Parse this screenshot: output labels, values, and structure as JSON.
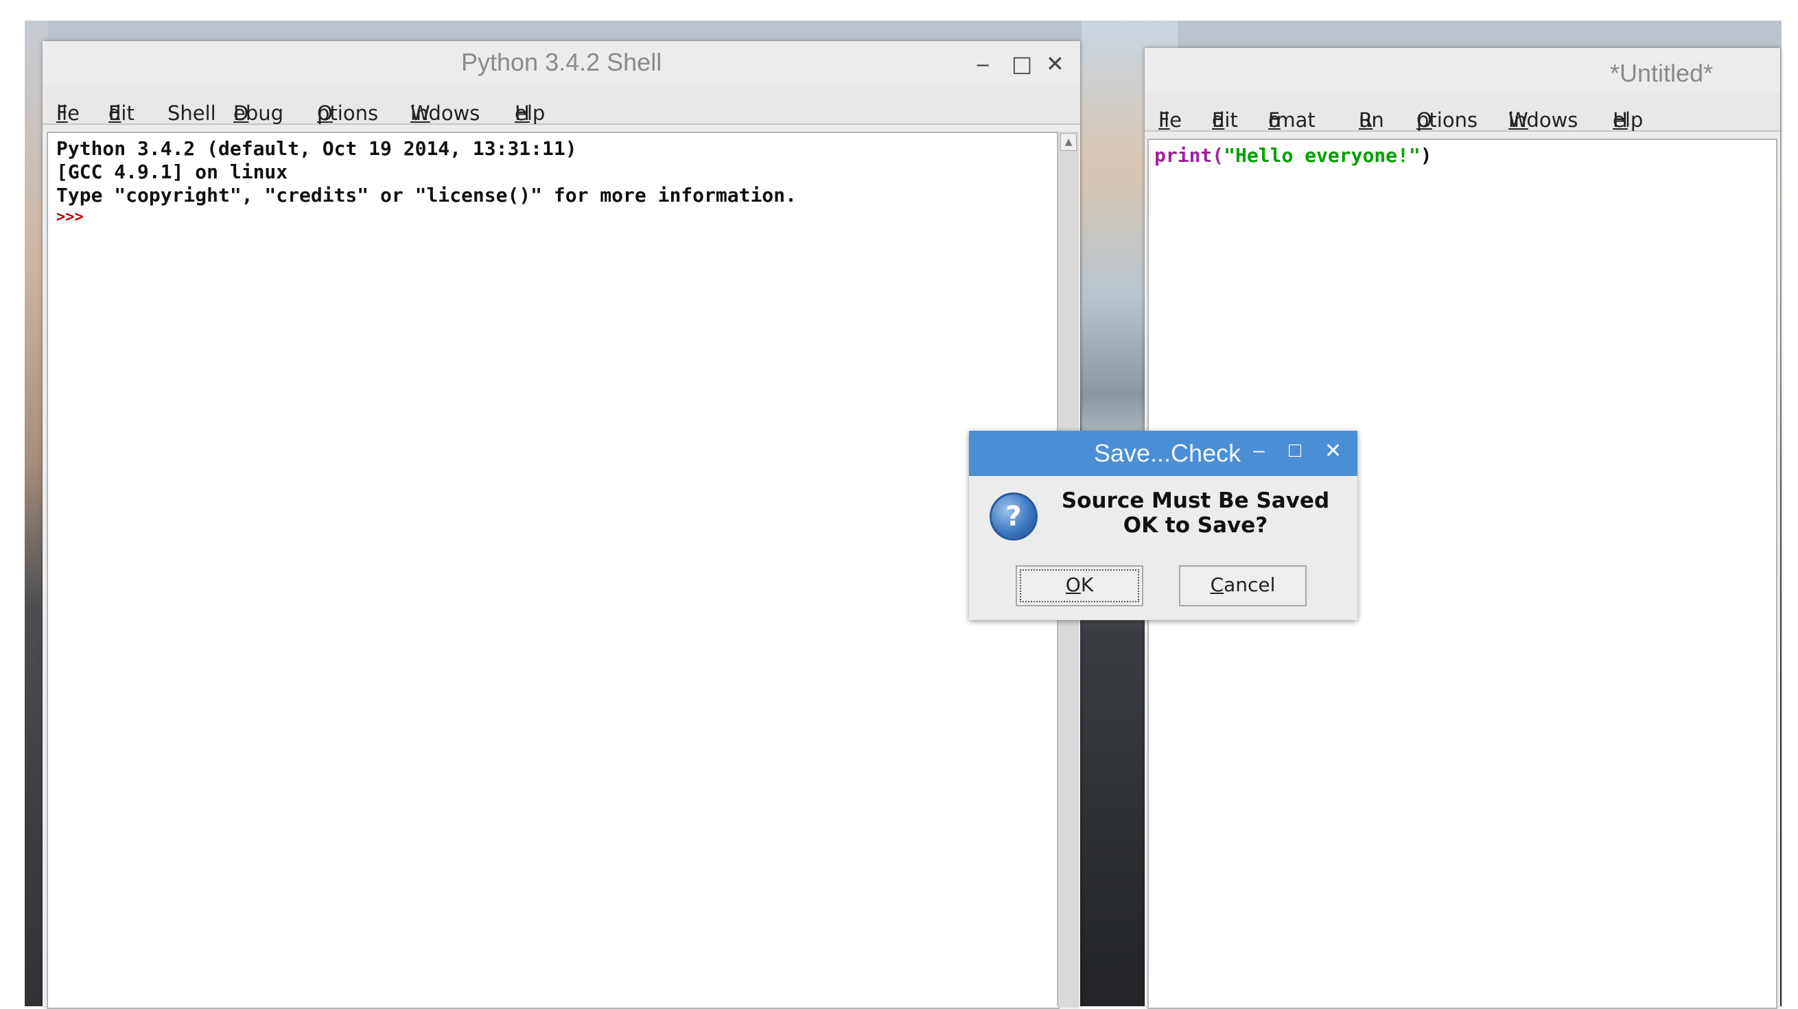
{
  "shell_window": {
    "title": "Python 3.4.2 Shell",
    "controls": {
      "minimize": "‒",
      "maximize": "□",
      "close": "✕"
    },
    "menu": [
      {
        "label": "File",
        "mnemonic": "F",
        "rest": "ile"
      },
      {
        "label": "Edit",
        "mnemonic": "E",
        "rest": "dit"
      },
      {
        "label": "Shell",
        "mnemonic": "",
        "rest": "Shell"
      },
      {
        "label": "Debug",
        "mnemonic": "D",
        "rest": "ebug"
      },
      {
        "label": "Options",
        "mnemonic": "O",
        "rest": "ptions"
      },
      {
        "label": "Windows",
        "mnemonic": "W",
        "rest": "indows"
      },
      {
        "label": "Help",
        "mnemonic": "H",
        "rest": "elp"
      }
    ],
    "lines": [
      "Python 3.4.2 (default, Oct 19 2014, 13:31:11)",
      "[GCC 4.9.1] on linux",
      "Type \"copyright\", \"credits\" or \"license()\" for more information."
    ],
    "prompt": ">>>"
  },
  "editor_window": {
    "title": "*Untitled*",
    "menu": [
      {
        "label": "File",
        "mnemonic": "F",
        "rest": "ile"
      },
      {
        "label": "Edit",
        "mnemonic": "E",
        "rest": "dit"
      },
      {
        "label": "Format",
        "pre": "F",
        "mnemonic": "o",
        "rest": "rmat"
      },
      {
        "label": "Run",
        "mnemonic": "R",
        "rest": "un"
      },
      {
        "label": "Options",
        "mnemonic": "O",
        "rest": "ptions"
      },
      {
        "label": "Windows",
        "mnemonic": "W",
        "rest": "indows"
      },
      {
        "label": "Help",
        "mnemonic": "H",
        "rest": "elp"
      }
    ],
    "code": {
      "keyword": "print(",
      "string": "\"Hello everyone!\"",
      "close": ")"
    }
  },
  "dialog": {
    "title": "Save...Check",
    "controls": {
      "minimize": "‒",
      "maximize": "□",
      "close": "✕"
    },
    "icon": "question-icon",
    "message_line1": "Source Must Be Saved",
    "message_line2": "OK to Save?",
    "ok_mnemonic": "O",
    "ok_rest": "K",
    "cancel_mnemonic": "C",
    "cancel_rest": "ancel"
  },
  "colors": {
    "dialog_titlebar": "#4a8fd6",
    "prompt": "#c00000",
    "code_keyword": "#a020a0",
    "code_string": "#00a000"
  }
}
